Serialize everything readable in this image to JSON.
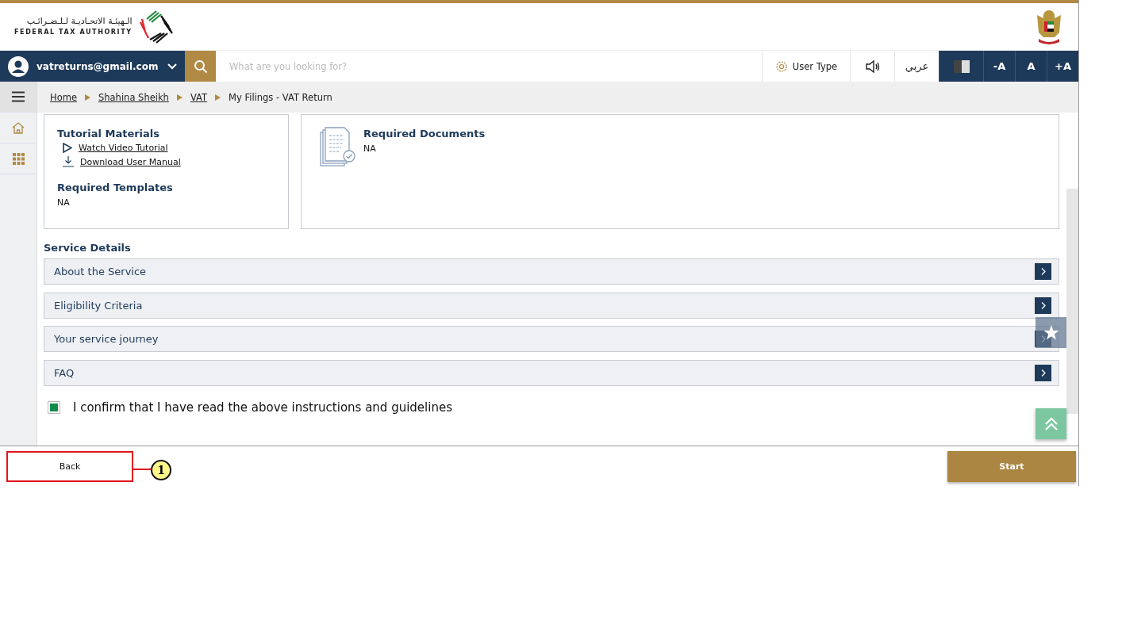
{
  "header": {
    "logo_arabic": "الـهيئـة الاتحـاديـة لـلـضـرائـب",
    "logo_english": "FEDERAL TAX AUTHORITY"
  },
  "nav": {
    "user_email": "vatreturns@gmail.com",
    "search_placeholder": "What are you looking for?",
    "user_type": "User Type",
    "language": "عربي",
    "font_buttons": [
      "-A",
      "A",
      "+A"
    ]
  },
  "breadcrumb": [
    {
      "label": "Home",
      "link": true
    },
    {
      "label": "Shahina Sheikh",
      "link": true
    },
    {
      "label": "VAT",
      "link": true
    },
    {
      "label": "My Filings - VAT Return",
      "link": false
    }
  ],
  "tutorial": {
    "title": "Tutorial Materials",
    "links": [
      {
        "kind": "video",
        "label": "Watch Video Tutorial"
      },
      {
        "kind": "download",
        "label": "Download User Manual"
      }
    ],
    "templates_title": "Required Templates",
    "templates_value": "NA"
  },
  "documents": {
    "title": "Required Documents",
    "value": "NA"
  },
  "service_details": {
    "title": "Service Details",
    "items": [
      {
        "label": "About the Service"
      },
      {
        "label": "Eligibility Criteria"
      },
      {
        "label": "Your service journey"
      },
      {
        "label": "FAQ"
      }
    ]
  },
  "confirm": {
    "label": "I confirm that I have read the above instructions and guidelines",
    "checked": true
  },
  "footer": {
    "back": {
      "label": "Back",
      "highlighted": true
    },
    "start": "Start"
  },
  "callout": {
    "label": "1"
  }
}
